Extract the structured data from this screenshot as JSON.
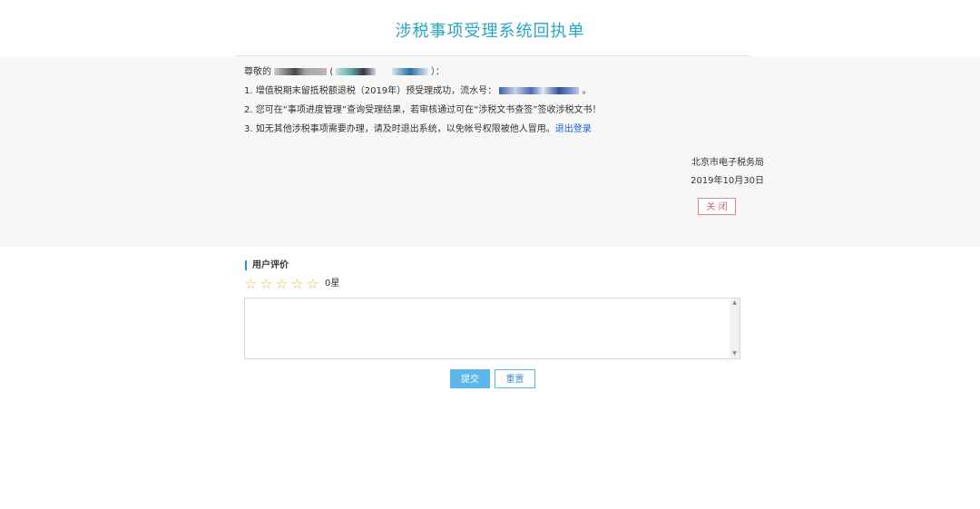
{
  "title": "涉税事项受理系统回执单",
  "receipt": {
    "greeting_prefix": "尊敬的",
    "greeting_suffix": "）：",
    "line1_prefix": "1. 增值税期末留抵税额退税（2019年）预受理成功，流水号：",
    "line1_suffix": "。",
    "line2": "2. 您可在“事项进度管理”查询受理结果，若审核通过可在“涉税文书查签”签收涉税文书！",
    "line3_prefix": "3. 如无其他涉税事项需要办理，请及时退出系统，以免帐号权限被他人冒用。",
    "logout_link": "退出登录",
    "authority": "北京市电子税务局",
    "date": "2019年10月30日",
    "close_label": "关 闭"
  },
  "rating": {
    "heading": "用户评价",
    "star_glyph": "☆",
    "score": "0星",
    "comment_value": ""
  },
  "buttons": {
    "submit": "提交",
    "reset": "重置"
  },
  "colors": {
    "title": "#2aa6c6",
    "link": "#1a5fd0",
    "star": "#e4b543",
    "primary": "#5bb6ea",
    "close_border": "#d98a8a"
  }
}
